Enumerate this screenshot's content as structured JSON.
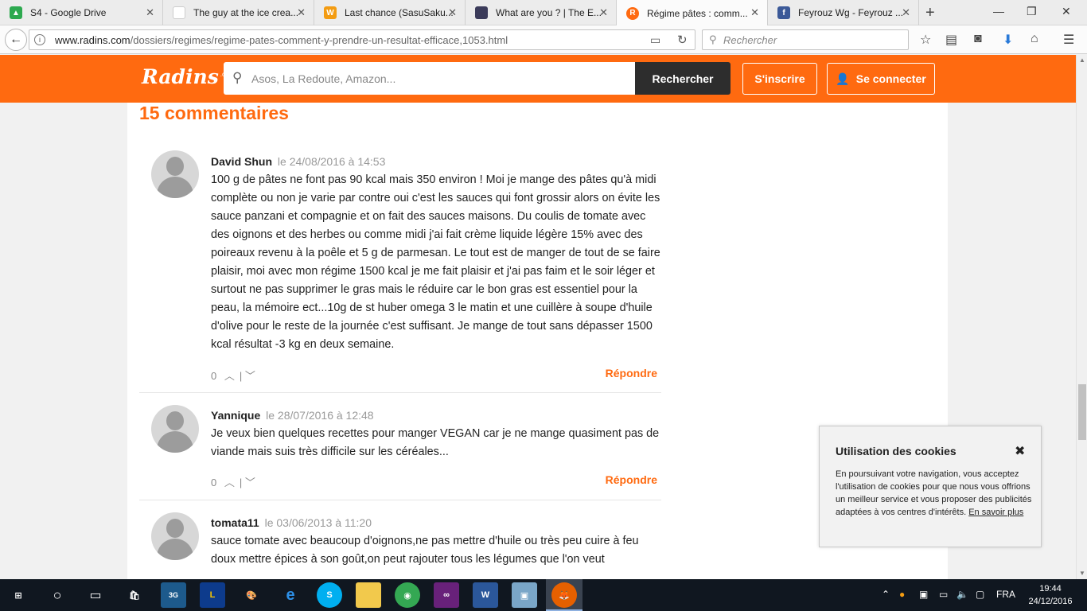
{
  "browser": {
    "tabs": [
      {
        "title": "S4 - Google Drive",
        "icon": "google-drive-icon",
        "color": "#2da94f"
      },
      {
        "title": "The guy at the ice crea...",
        "icon": "generic-page-icon",
        "color": "#d9d9d9"
      },
      {
        "title": "Last chance (SasuSaku...",
        "icon": "wattpad-icon",
        "color": "#f39c12"
      },
      {
        "title": "What are you ? | The E...",
        "icon": "site-icon",
        "color": "#3b3b5a"
      },
      {
        "title": "Régime pâtes : comm...",
        "icon": "radins-icon",
        "color": "#ff6a10"
      },
      {
        "title": "Feyrouz Wg - Feyrouz ...",
        "icon": "facebook-icon",
        "color": "#3b5998"
      }
    ],
    "url_domain": "www.radins.com",
    "url_path": "/dossiers/regimes/regime-pates-comment-y-prendre-un-resultat-efficace,1053.html",
    "search_placeholder": "Rechercher"
  },
  "site": {
    "logo": "Radins",
    "logo_suffix": ".com",
    "search_placeholder": "Asos, La Redoute, Amazon...",
    "search_button": "Rechercher",
    "signup_button": "S'inscrire",
    "login_button": "Se connecter",
    "brand_color": "#ff6a10"
  },
  "comments": {
    "title": "15 commentaires",
    "items": [
      {
        "author": "David Shun",
        "date": "le 24/08/2016 à 14:53",
        "text": "100 g de pâtes ne font pas 90 kcal mais 350 environ ! Moi je mange des pâtes qu'à midi complète ou non je varie par contre oui c'est les sauces qui font grossir alors on évite les sauce panzani et compagnie et on fait des sauces maisons. Du coulis de tomate avec des oignons et des herbes ou comme midi j'ai fait crème liquide légère 15% avec des poireaux revenu à la poêle et 5 g de parmesan. Le tout est de manger de tout de se faire plaisir, moi avec mon régime 1500 kcal je me fait plaisir et j'ai pas faim et le soir léger et surtout ne pas supprimer le gras mais le réduire car le bon gras est essentiel pour la peau, la mémoire ect...10g de st huber omega 3 le matin et une cuillère à soupe d'huile d'olive pour le reste de la journée c'est suffisant. Je mange de tout sans dépasser 1500 kcal résultat -3 kg en deux semaine.",
        "votes": "0",
        "reply": "Répondre"
      },
      {
        "author": "Yannique",
        "date": "le 28/07/2016 à 12:48",
        "text": "Je veux bien quelques recettes pour manger VEGAN car je ne mange quasiment pas de viande mais suis très difficile sur les céréales...",
        "votes": "0",
        "reply": "Répondre"
      },
      {
        "author": "tomata11",
        "date": "le 03/06/2013 à 11:20",
        "text": "sauce tomate avec beaucoup d'oignons,ne pas mettre d'huile ou très peu cuire à feu doux mettre épices à son goût,on peut rajouter tous les légumes que l'on veut",
        "votes": "",
        "reply": ""
      }
    ]
  },
  "cookie": {
    "title": "Utilisation des cookies",
    "text": "En poursuivant votre navigation, vous acceptez l'utilisation de cookies pour que nous vous offrions un meilleur service et vous proposer des publicités adaptées à vos centres d'intérêts.",
    "link": "En savoir plus"
  },
  "taskbar": {
    "language": "FRA",
    "time": "19:44",
    "date": "24/12/2016"
  }
}
